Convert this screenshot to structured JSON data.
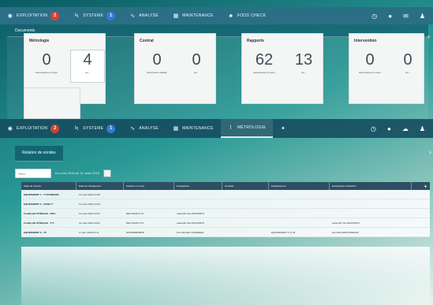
{
  "nav_top": {
    "items": [
      {
        "label": "EXPLOITATION",
        "badge": "2"
      },
      {
        "label": "SYSTEME",
        "badge": "1"
      },
      {
        "label": "ANALYSE"
      },
      {
        "label": "MAINTENANCE"
      },
      {
        "label": "FOOD CHECK"
      }
    ]
  },
  "dashboard": {
    "panel_title": "Documents",
    "cards": [
      {
        "title": "Métrologie",
        "v1": "0",
        "l1": "Documents en cours",
        "v2": "4",
        "l2": "Au..."
      },
      {
        "title": "Contrat",
        "v1": "0",
        "l1": "Documents validés",
        "v2": "0",
        "l2": "Au..."
      },
      {
        "title": "Rapports",
        "v1": "62",
        "l1": "Documents en cours",
        "v2": "13",
        "l2": "Au..."
      },
      {
        "title": "Intervention",
        "v1": "0",
        "l1": "Documents en cours",
        "v2": "0",
        "l2": "Au..."
      }
    ]
  },
  "nav_bottom": {
    "items": [
      {
        "label": "EXPLOITATION",
        "badge": "2"
      },
      {
        "label": "SYSTEME",
        "badge": "1"
      },
      {
        "label": "ANALYSE"
      },
      {
        "label": "MAINTENANCE"
      },
      {
        "label": "MÉTROLOGIE",
        "active": true
      }
    ]
  },
  "report": {
    "panel_title": "Relation de sondes",
    "search_placeholder": "Filtre...",
    "filter_text": "Du mois 2018 au 31 mars 2018",
    "columns": [
      "Objet de mesure",
      "Date de changement",
      "Capteur en cours",
      "Enregistreur",
      "Centrale",
      "Emplacement",
      "Enregistreur précédent"
    ],
    "rows": [
      {
        "c0": "EQUIPEMENT 1 - T°STANDARD",
        "c1": "19 mars 2018 14:38",
        "c2": "",
        "c3": "",
        "c4": "",
        "c5": "",
        "c6": ""
      },
      {
        "c0": "EQUIPEMENT 2 - CONG T°",
        "c1": "19 mars 2018 13:29",
        "c2": "",
        "c3": "",
        "c4": "",
        "c5": "",
        "c6": ""
      },
      {
        "c0": "Froid/Lyfle STORAGE - HPH",
        "c1": "19 mars 2018 10:20",
        "c2": "RE1720047V-70",
        "c3": "Label-RF 3H-415076097X",
        "c4": "",
        "c5": "",
        "c6": ""
      },
      {
        "c0": "Froid/Lyfle STORAGE - T°C",
        "c1": "19 mars 2018 10:01",
        "c2": "RE1720047V-72",
        "c3": "Label-RF 3H-415076097X",
        "c4": "",
        "c5": "",
        "c6": "Label-RF 3H-415076097X"
      },
      {
        "c0": "EQUIPEMENT 3 - TC",
        "c1": "17 janv 2018 10:11",
        "c2": "91544RB8008TE",
        "c3": "Nom RF11EY1XRMEE2H",
        "c4": "",
        "c5": "EQUIPEMENT 4 (1) ⚙",
        "c6": "Nom RF1WD1780S00SF"
      }
    ]
  }
}
